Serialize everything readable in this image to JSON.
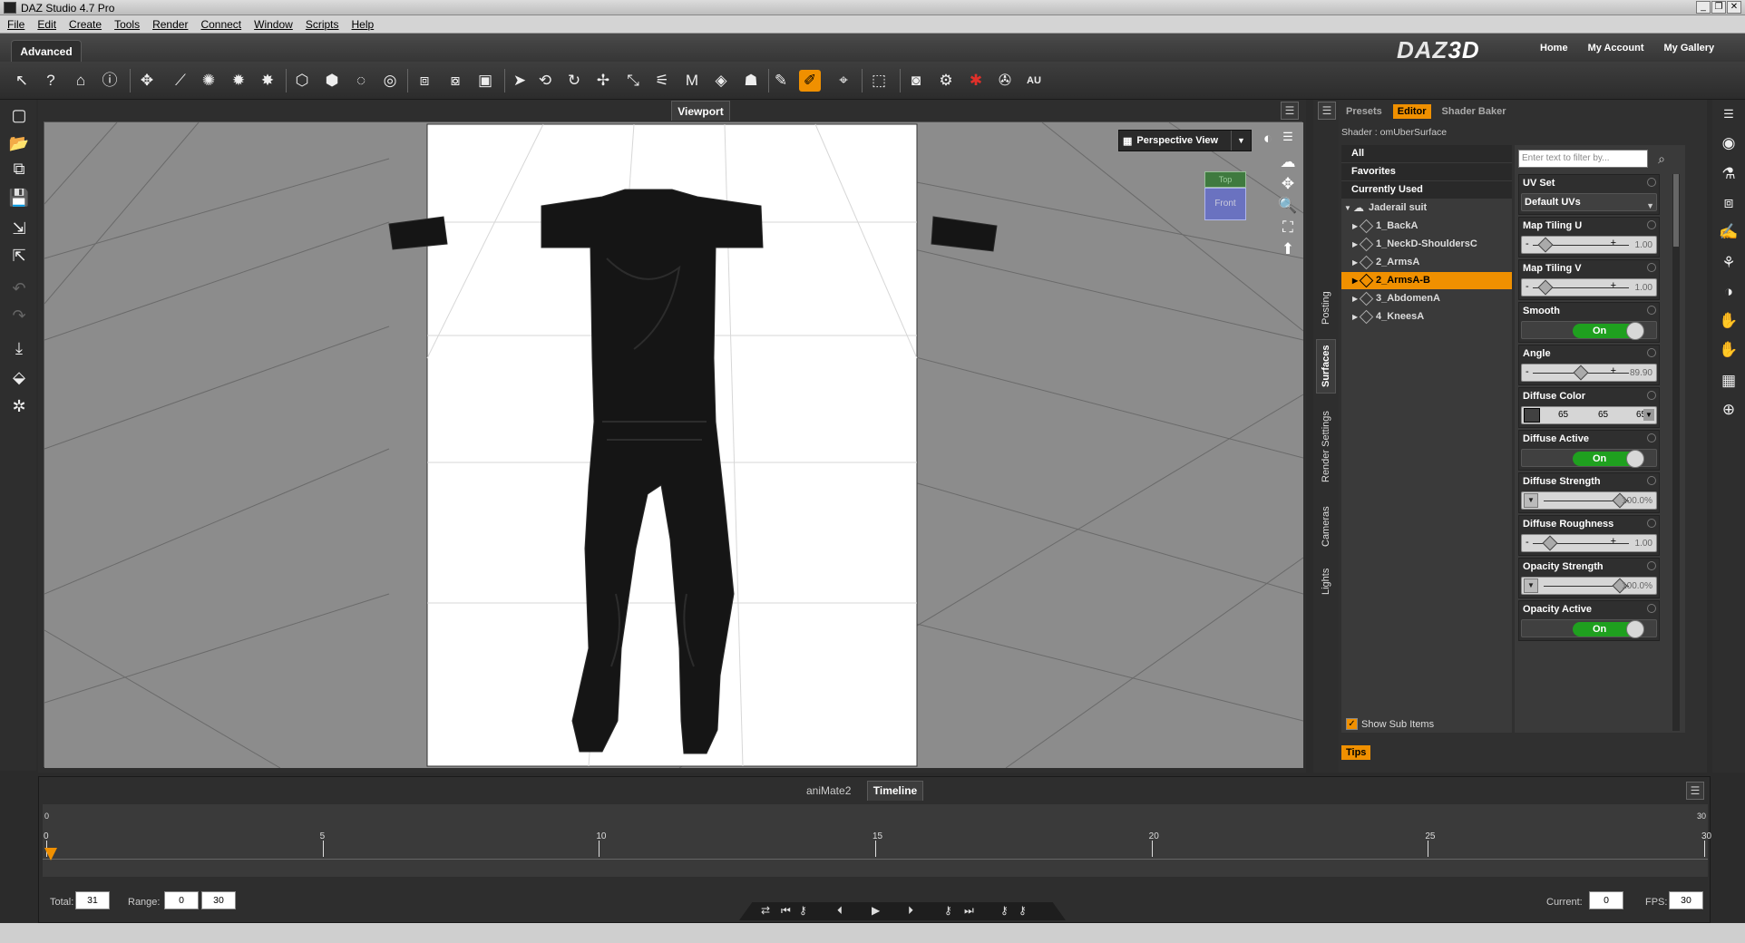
{
  "window": {
    "title": "DAZ Studio 4.7 Pro"
  },
  "menu": [
    "File",
    "Edit",
    "Create",
    "Tools",
    "Render",
    "Connect",
    "Window",
    "Scripts",
    "Help"
  ],
  "header": {
    "room_tab": "Advanced",
    "logo": "DAZ",
    "logo_accent": "3D",
    "links": [
      "Home",
      "My Account",
      "My Gallery"
    ]
  },
  "viewport": {
    "tab": "Viewport",
    "camera": "Perspective View",
    "cube_top": "Top",
    "cube_front": "Front",
    "background_color": "#8c8c8c",
    "canvas_color": "#ffffff",
    "figure_color": "#151515"
  },
  "side_tabs": [
    "Posting",
    "Surfaces",
    "Render Settings",
    "Cameras",
    "Lights"
  ],
  "right_panel": {
    "tabs": [
      "Presets",
      "Editor",
      "Shader Baker"
    ],
    "shader": "Shader : omUberSurface",
    "categories": [
      "All",
      "Favorites",
      "Currently Used"
    ],
    "root": "Jaderail suit",
    "surfaces": [
      "1_BackA",
      "1_NeckD-ShouldersC",
      "2_ArmsA",
      "2_ArmsA-B",
      "3_AbdomenA",
      "4_KneesA"
    ],
    "show_sub_items": "Show Sub Items",
    "tips": "Tips",
    "filter_placeholder": "Enter text to filter by...",
    "props": {
      "uv_set": {
        "label": "UV Set",
        "value": "Default UVs"
      },
      "map_tiling_u": {
        "label": "Map Tiling U",
        "value": "1.00",
        "level": 0.05
      },
      "map_tiling_v": {
        "label": "Map Tiling V",
        "value": "1.00",
        "level": 0.05
      },
      "smooth": {
        "label": "Smooth",
        "value": "On"
      },
      "angle": {
        "label": "Angle",
        "value": "89.90",
        "level": 0.5
      },
      "diffuse_color": {
        "label": "Diffuse Color",
        "r": "65",
        "g": "65",
        "b": "65"
      },
      "diffuse_active": {
        "label": "Diffuse Active",
        "value": "On"
      },
      "diffuse_strength": {
        "label": "Diffuse Strength",
        "value": "100.0%",
        "level": 1.0
      },
      "diffuse_roughness": {
        "label": "Diffuse Roughness",
        "value": "1.00",
        "level": 0.1
      },
      "opacity_strength": {
        "label": "Opacity Strength",
        "value": "100.0%",
        "level": 1.0
      },
      "opacity_active": {
        "label": "Opacity Active",
        "value": "On"
      }
    }
  },
  "timeline": {
    "tab_other": "aniMate2",
    "tab_active": "Timeline",
    "ticks": [
      "0",
      "5",
      "10",
      "15",
      "20",
      "25",
      "30"
    ],
    "range_top_left": "0",
    "range_top_right": "30",
    "total_label": "Total:",
    "total": "31",
    "range_label": "Range:",
    "range_start": "0",
    "range_end": "30",
    "current_label": "Current:",
    "current": "0",
    "fps_label": "FPS:",
    "fps": "30"
  },
  "accent_color": "#f09000"
}
